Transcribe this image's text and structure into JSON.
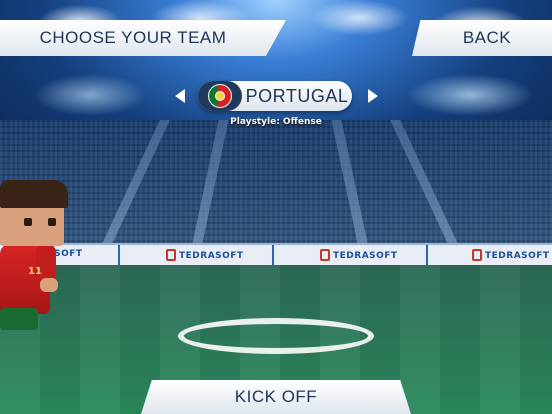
{
  "header": {
    "title": "CHOOSE YOUR TEAM",
    "back_label": "BACK"
  },
  "team_selector": {
    "team_name": "PORTUGAL",
    "playstyle": "Playstyle: Offense",
    "flag_icon": "portugal-flag-icon",
    "prev_icon": "left-arrow-icon",
    "next_icon": "right-arrow-icon"
  },
  "stadium": {
    "board_text": "TEDRASOFT"
  },
  "player": {
    "shirt_number": "11"
  },
  "footer": {
    "kickoff_label": "KICK OFF"
  },
  "colors": {
    "button_bg": "#ffffff",
    "button_text": "#1d3557",
    "portugal_red": "#d42222",
    "portugal_green": "#0b7a2e"
  }
}
